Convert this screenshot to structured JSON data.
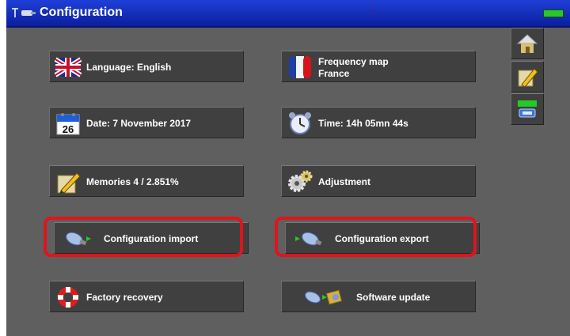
{
  "titlebar": {
    "title": "Configuration",
    "status_line1": "...",
    "status_line2": "..."
  },
  "menu": {
    "language": "Language: English",
    "frequency_map_line1": "Frequency map",
    "frequency_map_line2": "France",
    "date": "Date: 7 November 2017",
    "date_icon_day": "26",
    "time": "Time: 14h 05mn 44s",
    "memories": "Memories 4 /  2.851%",
    "adjustment": "Adjustment",
    "config_import": "Configuration import",
    "config_export": "Configuration export",
    "factory_recovery": "Factory recovery",
    "software_update": "Software update"
  },
  "side_buttons": {
    "home": "home-icon",
    "edit": "pencil-icon",
    "transfer": "usb-transfer-icon"
  },
  "colors": {
    "highlight": "#e0141c",
    "title_bar": "#1f3fd8",
    "battery": "#2cc62a"
  }
}
